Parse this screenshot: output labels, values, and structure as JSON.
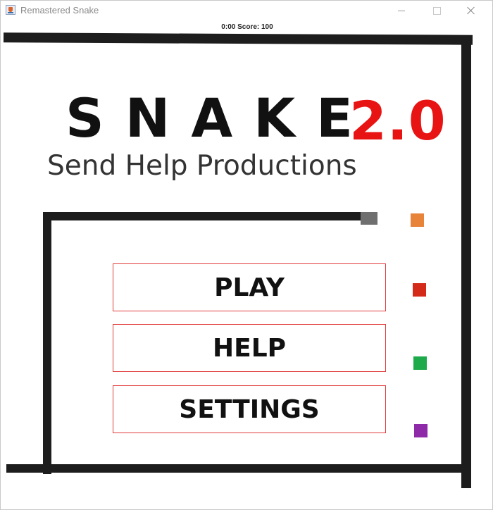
{
  "window": {
    "title": "Remastered Snake",
    "icon": "java-app-icon",
    "controls": [
      "minimize-icon",
      "maximize-icon",
      "close-icon"
    ]
  },
  "status": {
    "text": "0:00  Score: 100"
  },
  "logo": {
    "title": "SNAKE",
    "version": "2.0",
    "subtitle": "Send Help Productions",
    "colors": {
      "title": "#111111",
      "version": "#e81414"
    }
  },
  "menu": {
    "buttons": [
      {
        "label": "PLAY"
      },
      {
        "label": "HELP"
      },
      {
        "label": "SETTINGS"
      }
    ],
    "border_color": "#e23b3b"
  },
  "board": {
    "wall_color": "#1d1d1d",
    "snake_head_color": "#6f6f6f",
    "food": [
      {
        "color": "#e8833a"
      },
      {
        "color": "#d42a1a"
      },
      {
        "color": "#1daa4a"
      },
      {
        "color": "#8e2aa8"
      }
    ]
  }
}
